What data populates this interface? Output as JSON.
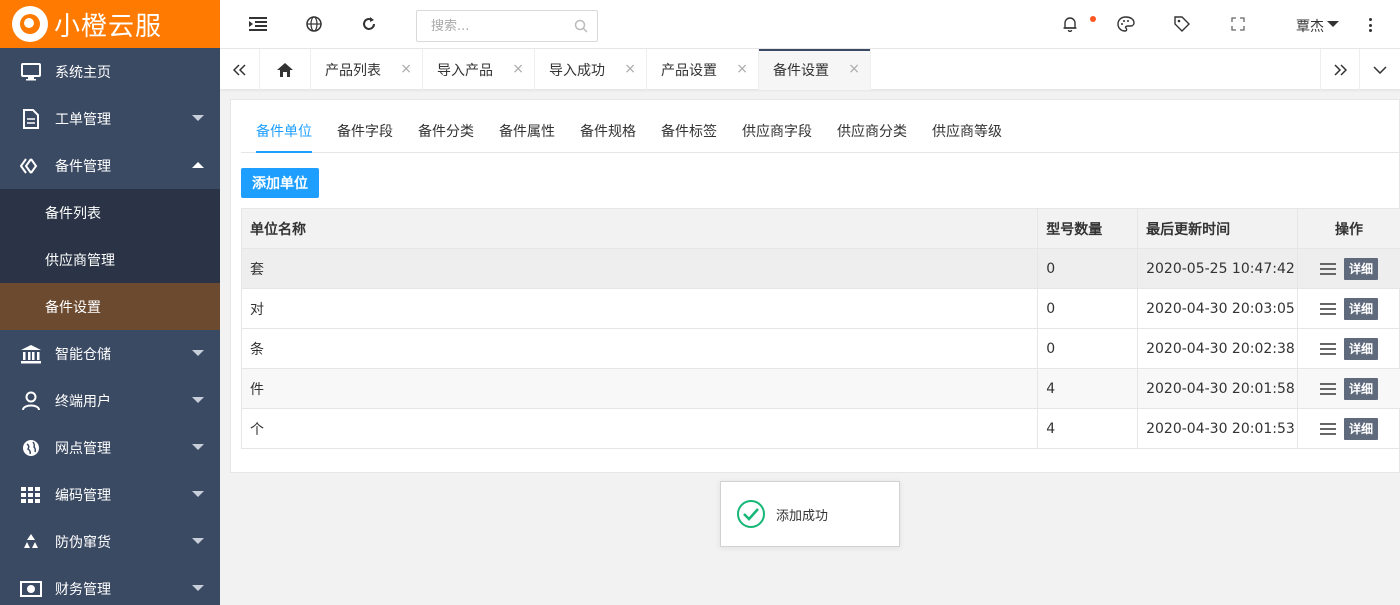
{
  "app": {
    "title": "小橙云服",
    "brand_color": "#ff7a00",
    "accent_color": "#1e9fff",
    "sidebar_color": "#3b4a63"
  },
  "sidebar": {
    "items": [
      {
        "label": "系统主页",
        "icon": "monitor-icon"
      },
      {
        "label": "工单管理",
        "icon": "document-icon"
      },
      {
        "label": "备件管理",
        "icon": "diamond-icon",
        "expanded": true,
        "children": [
          {
            "label": "备件列表"
          },
          {
            "label": "供应商管理"
          },
          {
            "label": "备件设置",
            "active": true
          }
        ]
      },
      {
        "label": "智能仓储",
        "icon": "bank-icon"
      },
      {
        "label": "终端用户",
        "icon": "user-icon"
      },
      {
        "label": "网点管理",
        "icon": "globe-icon"
      },
      {
        "label": "编码管理",
        "icon": "grid-icon"
      },
      {
        "label": "防伪窜货",
        "icon": "recycle-icon"
      },
      {
        "label": "财务管理",
        "icon": "money-icon"
      }
    ]
  },
  "topbar": {
    "search_placeholder": "搜索...",
    "user_name": "覃杰"
  },
  "tabs": [
    {
      "label": "产品列表"
    },
    {
      "label": "导入产品"
    },
    {
      "label": "导入成功"
    },
    {
      "label": "产品设置"
    },
    {
      "label": "备件设置",
      "active": true
    }
  ],
  "tab_close": "×",
  "subtabs": [
    "备件单位",
    "备件字段",
    "备件分类",
    "备件属性",
    "备件规格",
    "备件标签",
    "供应商字段",
    "供应商分类",
    "供应商等级"
  ],
  "add_button": "添加单位",
  "table": {
    "headers": [
      "单位名称",
      "型号数量",
      "最后更新时间",
      "操作"
    ],
    "rows": [
      {
        "name": "套",
        "count": "0",
        "updated": "2020-05-25 10:47:42"
      },
      {
        "name": "对",
        "count": "0",
        "updated": "2020-04-30 20:03:05"
      },
      {
        "name": "条",
        "count": "0",
        "updated": "2020-04-30 20:02:38"
      },
      {
        "name": "件",
        "count": "4",
        "updated": "2020-04-30 20:01:58"
      },
      {
        "name": "个",
        "count": "4",
        "updated": "2020-04-30 20:01:53"
      }
    ],
    "detail_label": "详细"
  },
  "toast": {
    "message": "添加成功"
  }
}
